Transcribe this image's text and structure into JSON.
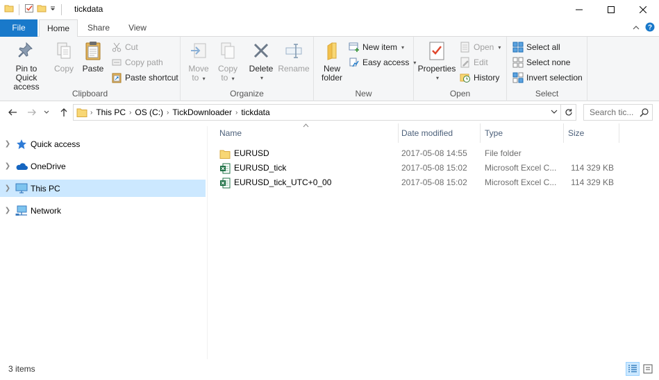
{
  "window": {
    "title": "tickdata"
  },
  "tabs": {
    "file": "File",
    "home": "Home",
    "share": "Share",
    "view": "View"
  },
  "ribbon": {
    "clipboard": {
      "label": "Clipboard",
      "pin_line1": "Pin to Quick",
      "pin_line2": "access",
      "copy": "Copy",
      "paste": "Paste",
      "cut": "Cut",
      "copy_path": "Copy path",
      "paste_shortcut": "Paste shortcut"
    },
    "organize": {
      "label": "Organize",
      "move_to_line1": "Move",
      "move_to_line2": "to",
      "copy_to_line1": "Copy",
      "copy_to_line2": "to",
      "delete": "Delete",
      "rename": "Rename"
    },
    "new": {
      "label": "New",
      "new_folder_line1": "New",
      "new_folder_line2": "folder",
      "new_item": "New item",
      "easy_access": "Easy access"
    },
    "open": {
      "label": "Open",
      "properties": "Properties",
      "open": "Open",
      "edit": "Edit",
      "history": "History"
    },
    "select": {
      "label": "Select",
      "select_all": "Select all",
      "select_none": "Select none",
      "invert_selection": "Invert selection"
    }
  },
  "address": {
    "crumbs": [
      "This PC",
      "OS (C:)",
      "TickDownloader",
      "tickdata"
    ]
  },
  "search": {
    "placeholder": "Search tic..."
  },
  "navpane": {
    "items": [
      {
        "label": "Quick access"
      },
      {
        "label": "OneDrive"
      },
      {
        "label": "This PC"
      },
      {
        "label": "Network"
      }
    ]
  },
  "columns": {
    "name": "Name",
    "date": "Date modified",
    "type": "Type",
    "size": "Size"
  },
  "files": [
    {
      "name": "EURUSD",
      "date": "2017-05-08 14:55",
      "type": "File folder",
      "size": ""
    },
    {
      "name": "EURUSD_tick",
      "date": "2017-05-08 15:02",
      "type": "Microsoft Excel C...",
      "size": "114 329 KB"
    },
    {
      "name": "EURUSD_tick_UTC+0_00",
      "date": "2017-05-08 15:02",
      "type": "Microsoft Excel C...",
      "size": "114 329 KB"
    }
  ],
  "status": {
    "items_count": "3 items"
  },
  "colors": {
    "file_tab": "#1979ca",
    "selected": "#cce8ff",
    "folder": "#f8d775",
    "excel": "#1d7044"
  }
}
